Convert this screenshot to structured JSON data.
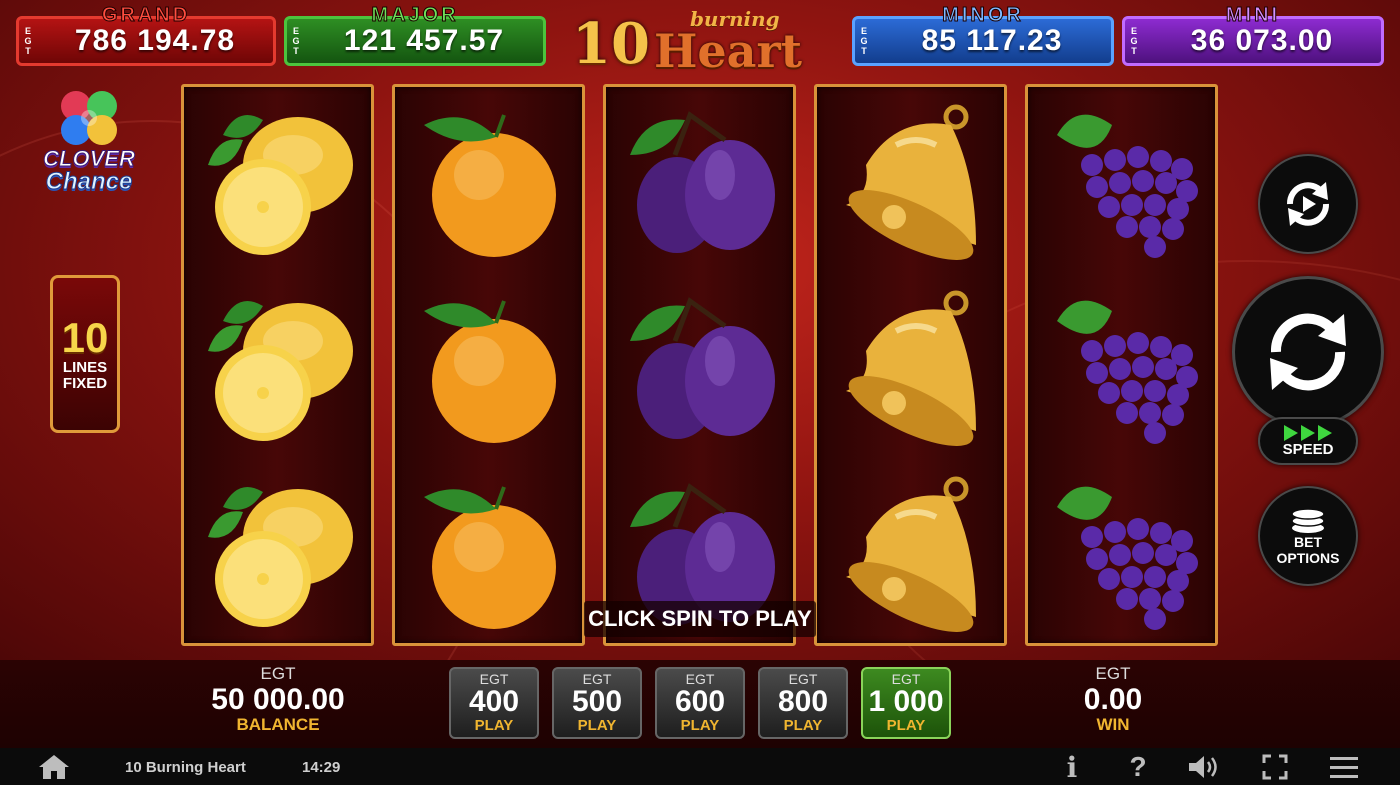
{
  "jackpots": {
    "grand": {
      "title": "GRAND",
      "value": "786 194.78",
      "side": "EGT"
    },
    "major": {
      "title": "MAJOR",
      "value": "121 457.57",
      "side": "EGT"
    },
    "minor": {
      "title": "MINOR",
      "value": "85 117.23",
      "side": "EGT"
    },
    "mini": {
      "title": "MINI",
      "value": "36 073.00",
      "side": "EGT"
    }
  },
  "logo": {
    "number": "10",
    "word1": "burning",
    "word2": "Heart"
  },
  "clover": {
    "line1": "CLOVER",
    "line2": "Chance"
  },
  "lines": {
    "number": "10",
    "label1": "LINES",
    "label2": "FIXED"
  },
  "reels": [
    [
      "lemon",
      "lemon",
      "lemon"
    ],
    [
      "orange",
      "orange",
      "orange"
    ],
    [
      "plum",
      "plum",
      "plum"
    ],
    [
      "bell",
      "bell",
      "bell"
    ],
    [
      "grapes",
      "grapes",
      "grapes"
    ]
  ],
  "message": "CLICK SPIN TO PLAY",
  "controls": {
    "autoplay_icon": "autoplay-icon",
    "spin_icon": "spin-icon",
    "speed_label": "SPEED",
    "bet_options_line1": "BET",
    "bet_options_line2": "OPTIONS"
  },
  "balance": {
    "currency": "EGT",
    "value": "50 000.00",
    "label": "BALANCE"
  },
  "win": {
    "currency": "EGT",
    "value": "0.00",
    "label": "WIN"
  },
  "bets": [
    {
      "currency": "EGT",
      "amount": "400",
      "label": "PLAY",
      "active": false
    },
    {
      "currency": "EGT",
      "amount": "500",
      "label": "PLAY",
      "active": false
    },
    {
      "currency": "EGT",
      "amount": "600",
      "label": "PLAY",
      "active": false
    },
    {
      "currency": "EGT",
      "amount": "800",
      "label": "PLAY",
      "active": false
    },
    {
      "currency": "EGT",
      "amount": "1 000",
      "label": "PLAY",
      "active": true
    }
  ],
  "footer": {
    "game_title": "10 Burning Heart",
    "time": "14:29",
    "info_glyph": "i",
    "help_glyph": "?"
  }
}
